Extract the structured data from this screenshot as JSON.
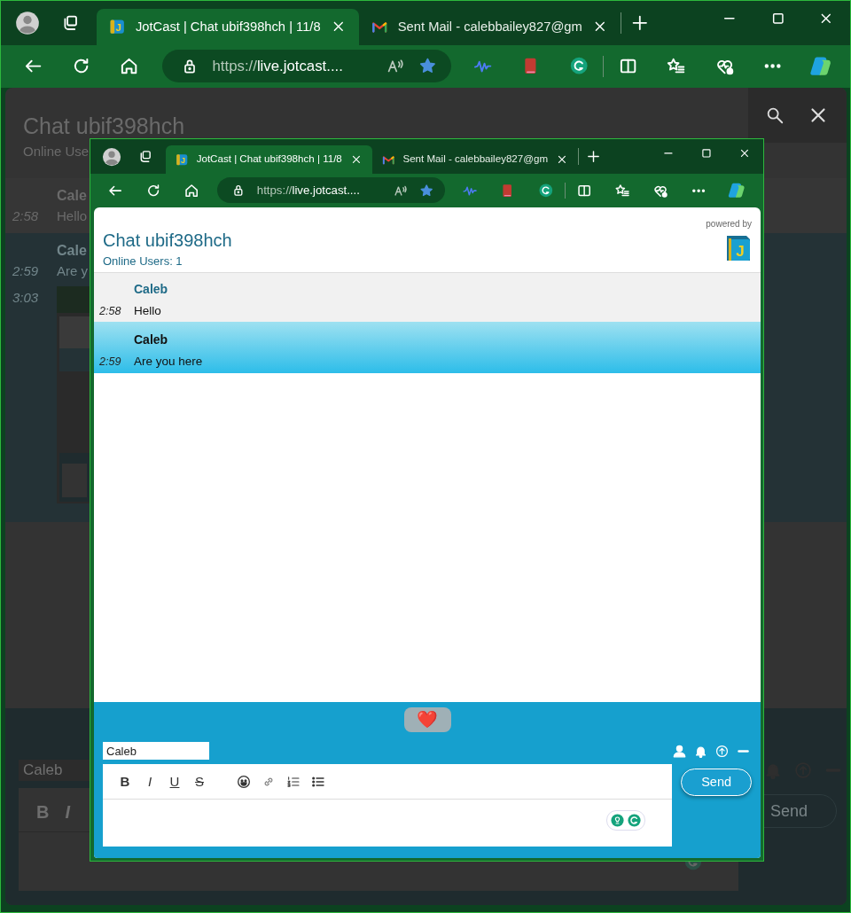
{
  "outer_browser": {
    "tabs": [
      {
        "title": "JotCast | Chat ubif398hch | 11/8",
        "kind": "jotcast",
        "favicon_letter": "J",
        "selected": true
      },
      {
        "title": "Sent Mail - calebbailey827@gm",
        "kind": "gmail",
        "selected": false
      }
    ],
    "address": {
      "scheme": "https://",
      "rest": "live.jotcast...."
    }
  },
  "background_page": {
    "title": "Chat ubif398hch",
    "subtitle": "Online Use",
    "messages": [
      {
        "author": "Cale",
        "time": "2:58",
        "text": "Hello",
        "selected": false
      },
      {
        "author": "Cale",
        "time": "2:59",
        "text": "Are y",
        "selected": true
      },
      {
        "time": "3:03",
        "kind": "screenshot",
        "selected": true
      }
    ],
    "name_value": "Caleb",
    "format_buttons": [
      "B",
      "I"
    ],
    "send": "Send"
  },
  "inner_browser": {
    "tabs": [
      {
        "title": "JotCast | Chat ubif398hch | 11/8",
        "kind": "jotcast",
        "favicon_letter": "J",
        "selected": true
      },
      {
        "title": "Sent Mail - calebbailey827@gm",
        "kind": "gmail",
        "selected": false
      }
    ],
    "address": {
      "scheme": "https://",
      "rest": "live.jotcast...."
    }
  },
  "chat": {
    "title": "Chat ubif398hch",
    "online": "Online Users: 1",
    "powered_by": "powered by",
    "logo_letter": "J",
    "messages": [
      {
        "author": "Caleb",
        "time": "2:58",
        "text": "Hello",
        "selected": false
      },
      {
        "author": "Caleb",
        "time": "2:59",
        "text": "Are you here",
        "selected": true
      }
    ],
    "reaction": "❤️",
    "name_value": "Caleb",
    "format_buttons": [
      "B",
      "I",
      "U",
      "S"
    ],
    "send": "Send"
  }
}
